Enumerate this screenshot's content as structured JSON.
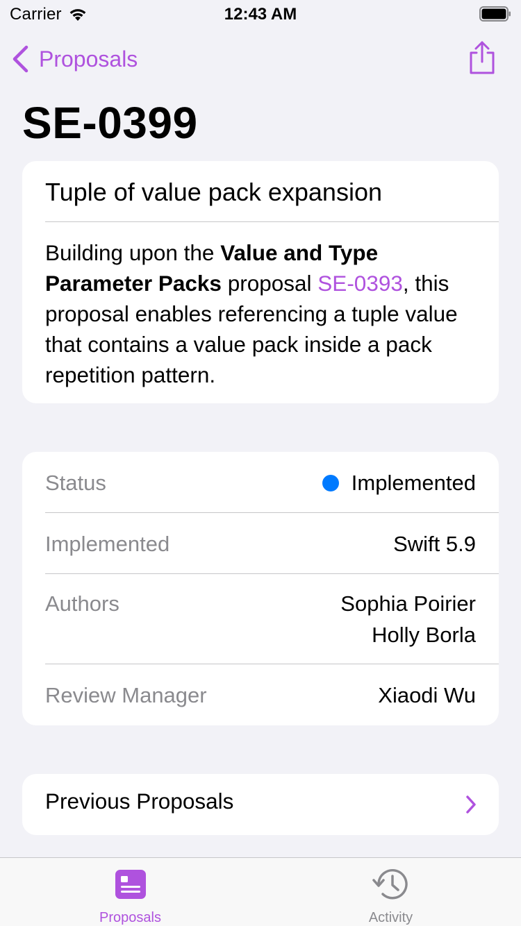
{
  "status_bar": {
    "carrier": "Carrier",
    "time": "12:43 AM"
  },
  "nav": {
    "back_label": "Proposals",
    "title": "SE-0399"
  },
  "summary": {
    "title": "Tuple of value pack expansion",
    "body_intro": "Building upon the ",
    "body_bold": "Value and Type Parameter Packs",
    "body_mid": " proposal ",
    "body_link": "SE-0393",
    "body_rest": ", this proposal enables referencing a tuple value that contains a value pack inside a pack repetition pattern."
  },
  "details": {
    "status_label": "Status",
    "status_value": "Implemented",
    "implemented_label": "Implemented",
    "implemented_value": "Swift 5.9",
    "authors_label": "Authors",
    "authors": [
      "Sophia Poirier",
      "Holly Borla"
    ],
    "review_manager_label": "Review Manager",
    "review_manager_value": "Xiaodi Wu"
  },
  "previous": {
    "label": "Previous Proposals"
  },
  "tabs": [
    {
      "label": "Proposals",
      "icon": "document-icon",
      "selected": true
    },
    {
      "label": "Activity",
      "icon": "history-icon",
      "selected": false
    }
  ],
  "colors": {
    "accent": "#af52de",
    "status_dot": "#007aff",
    "secondary_text": "#8a8a8e",
    "background": "#f2f2f7"
  }
}
